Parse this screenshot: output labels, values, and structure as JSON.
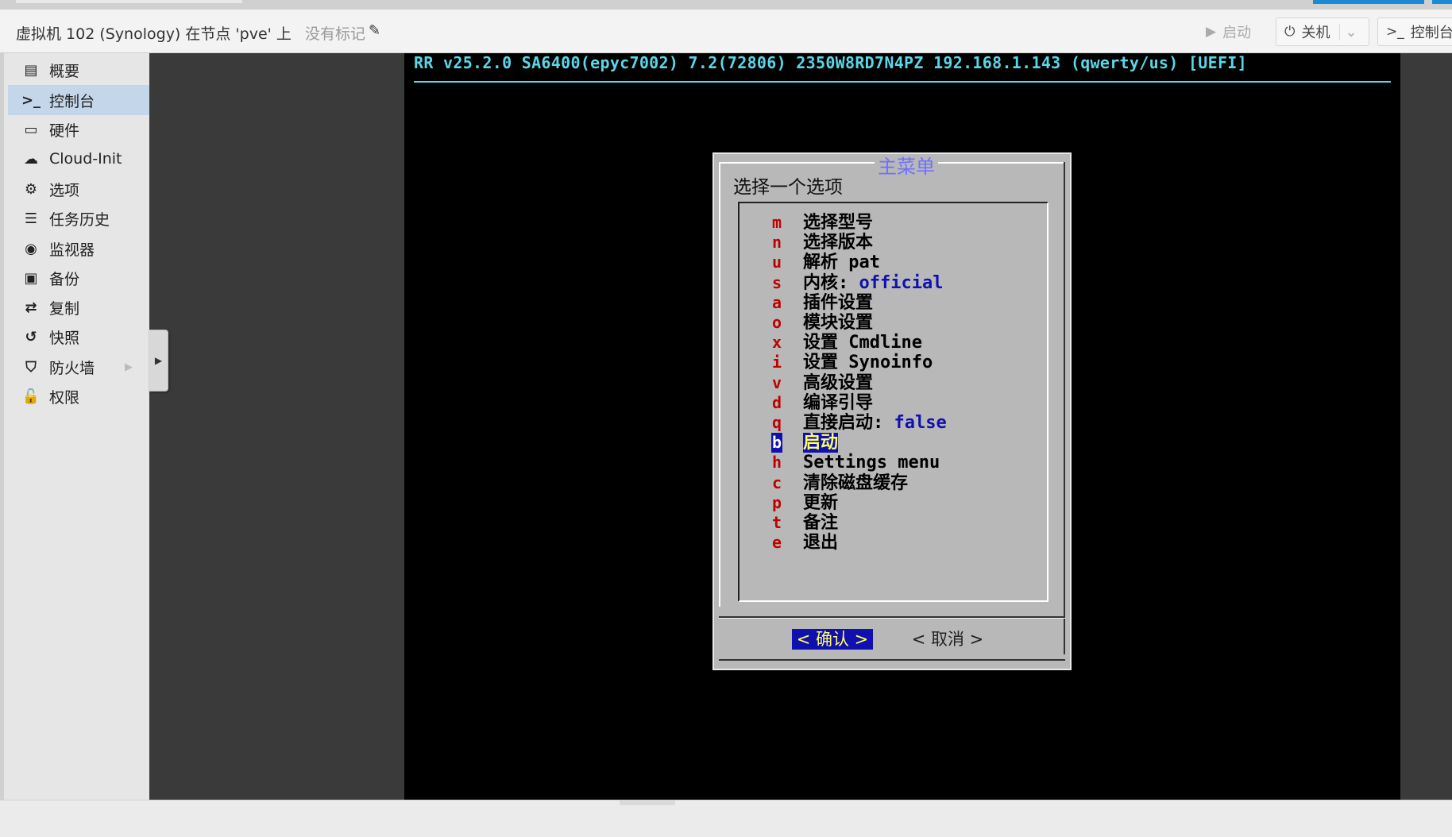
{
  "header": {
    "title": "虚拟机 102 (Synology) 在节点 'pve' 上",
    "tags": "没有标记",
    "buttons": {
      "start": "启动",
      "shutdown": "关机",
      "console": "控制台"
    }
  },
  "sidebar": {
    "items": [
      {
        "label": "概要",
        "icon": "book-icon",
        "glyph": "▤"
      },
      {
        "label": "控制台",
        "icon": "terminal-icon",
        "glyph": ">_"
      },
      {
        "label": "硬件",
        "icon": "monitor-icon",
        "glyph": "▭"
      },
      {
        "label": "Cloud-Init",
        "icon": "cloud-icon",
        "glyph": "☁"
      },
      {
        "label": "选项",
        "icon": "gear-icon",
        "glyph": "⚙"
      },
      {
        "label": "任务历史",
        "icon": "list-icon",
        "glyph": "☰"
      },
      {
        "label": "监视器",
        "icon": "eye-icon",
        "glyph": "◉"
      },
      {
        "label": "备份",
        "icon": "floppy-icon",
        "glyph": "▣"
      },
      {
        "label": "复制",
        "icon": "retweet-icon",
        "glyph": "⇄"
      },
      {
        "label": "快照",
        "icon": "history-icon",
        "glyph": "↺"
      },
      {
        "label": "防火墙",
        "icon": "shield-icon",
        "glyph": "⛉"
      },
      {
        "label": "权限",
        "icon": "unlock-icon",
        "glyph": "🔓"
      }
    ],
    "active_index": 1
  },
  "terminal": {
    "header": "RR v25.2.0 SA6400(epyc7002) 7.2(72806) 2350W8RD7N4PZ 192.168.1.143 (qwerty/us) [UEFI]",
    "dialog": {
      "title": "主菜单",
      "prompt": "选择一个选项",
      "items": [
        {
          "key": "m",
          "label": "选择型号",
          "value": ""
        },
        {
          "key": "n",
          "label": "选择版本",
          "value": ""
        },
        {
          "key": "u",
          "label": "解析 pat",
          "value": ""
        },
        {
          "key": "s",
          "label": "内核: ",
          "value": "official"
        },
        {
          "key": "a",
          "label": "插件设置",
          "value": ""
        },
        {
          "key": "o",
          "label": "模块设置",
          "value": ""
        },
        {
          "key": "x",
          "label": "设置 Cmdline",
          "value": ""
        },
        {
          "key": "i",
          "label": "设置 Synoinfo",
          "value": ""
        },
        {
          "key": "v",
          "label": "高级设置",
          "value": ""
        },
        {
          "key": "d",
          "label": "编译引导",
          "value": ""
        },
        {
          "key": "q",
          "label": "直接启动: ",
          "value": "false"
        },
        {
          "key": "b",
          "label": "启动",
          "value": ""
        },
        {
          "key": "h",
          "label": "Settings menu",
          "value": ""
        },
        {
          "key": "c",
          "label": "清除磁盘缓存",
          "value": ""
        },
        {
          "key": "p",
          "label": "更新",
          "value": ""
        },
        {
          "key": "t",
          "label": "备注",
          "value": ""
        },
        {
          "key": "e",
          "label": "退出",
          "value": ""
        }
      ],
      "selected_index": 11,
      "ok_label": "< 确认 >",
      "cancel_label": "< 取消 >"
    }
  },
  "colors": {
    "terminal_cyan": "#5ad7e8",
    "dialog_bg": "#b8b8b8",
    "selection_bg": "#1010b0",
    "selection_fg": "#ffff60",
    "hotkey": "#c00000",
    "sidebar_active": "#c4d6ea"
  }
}
